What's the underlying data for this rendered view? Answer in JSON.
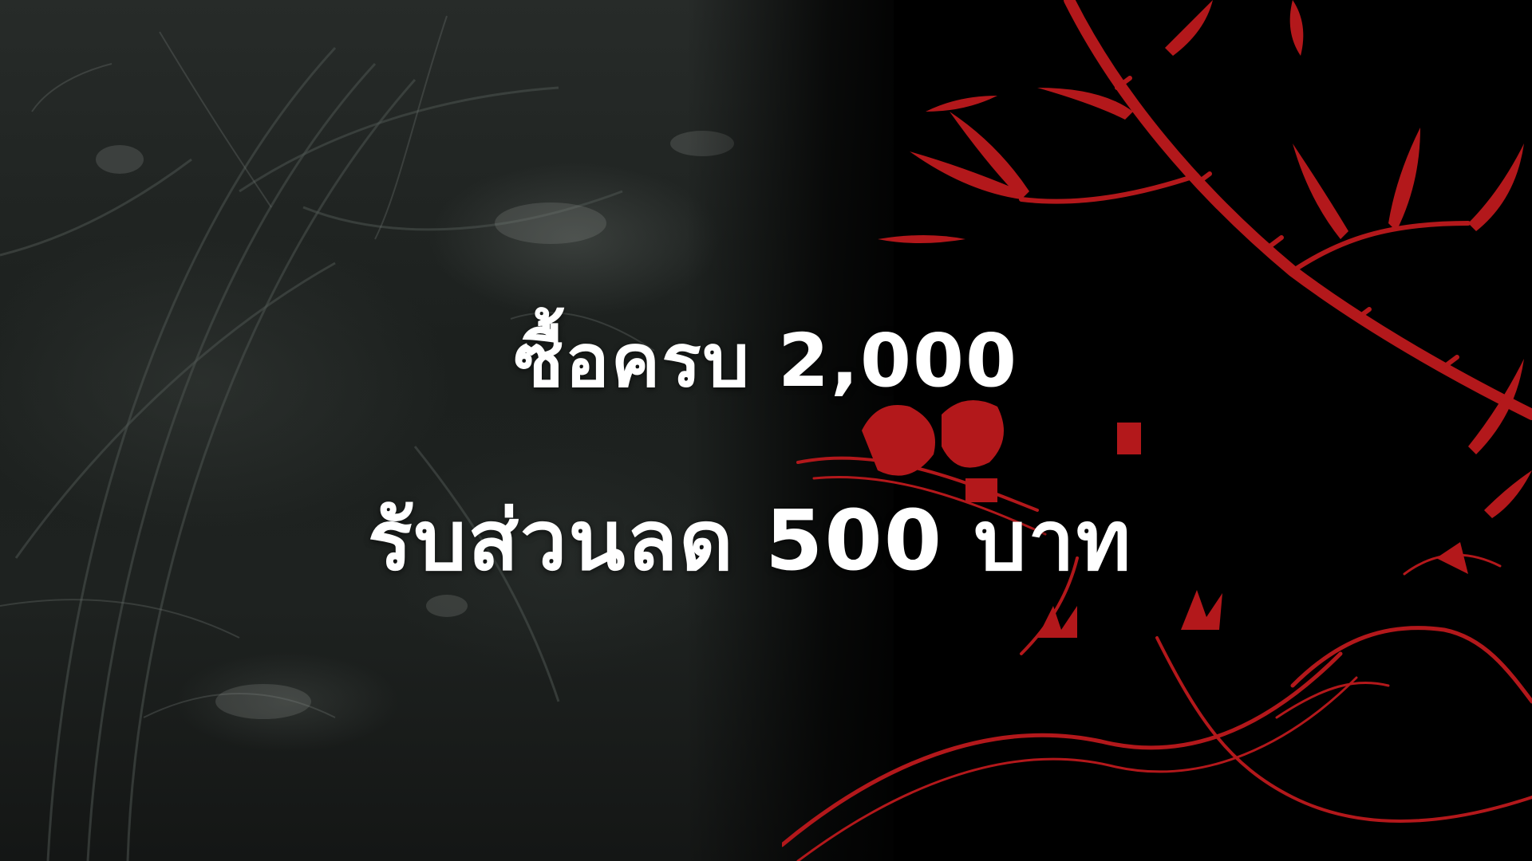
{
  "promo": {
    "line1": "ซื้อครบ 2,000",
    "line2": "รับส่วนลด 500 บาท"
  },
  "colors": {
    "background": "#000000",
    "left_panel": "#1e2220",
    "art_red": "#b3181b",
    "text": "#ffffff"
  },
  "artwork": {
    "left": "dark-scratched-texture",
    "right": "red-dragon-and-bamboo-illustration"
  }
}
